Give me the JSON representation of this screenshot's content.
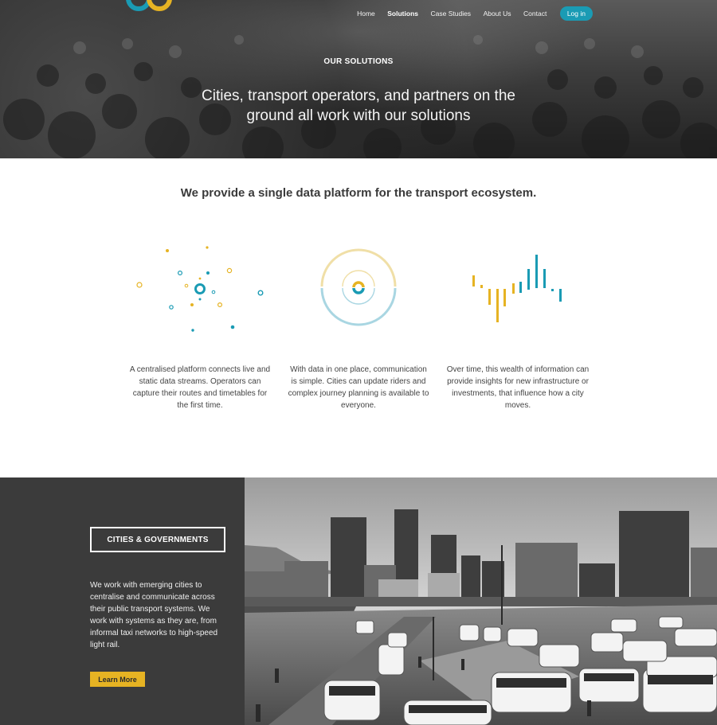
{
  "nav": {
    "items": [
      {
        "label": "Home",
        "active": false
      },
      {
        "label": "Solutions",
        "active": true
      },
      {
        "label": "Case Studies",
        "active": false
      },
      {
        "label": "About Us",
        "active": false
      },
      {
        "label": "Contact",
        "active": false
      }
    ],
    "login_label": "Log in"
  },
  "hero": {
    "eyebrow": "OUR SOLUTIONS",
    "title": "Cities, transport operators, and partners on the ground all work with our solutions"
  },
  "platform": {
    "heading": "We provide a single data platform for the transport ecosystem.",
    "features": [
      {
        "icon": "data-streams-icon",
        "text": "A centralised platform connects live and static data streams. Operators can capture their routes and timetables for the first time."
      },
      {
        "icon": "communication-rings-icon",
        "text": "With data in one place, communication is simple. Cities can update riders and complex journey planning is available to everyone."
      },
      {
        "icon": "insights-bars-icon",
        "text": "Over time, this wealth of information can provide insights for new infrastructure or investments, that influence how a city moves."
      }
    ]
  },
  "cities": {
    "badge": "CITIES & GOVERNMENTS",
    "text": "We work with emerging cities to centralise and communicate across their public transport systems. We work with systems as they are, from informal taxi networks to high-speed light rail.",
    "button": "Learn More"
  },
  "colors": {
    "teal": "#1a9bb4",
    "gold": "#e6b323",
    "dark_panel": "#3b3b3b"
  }
}
